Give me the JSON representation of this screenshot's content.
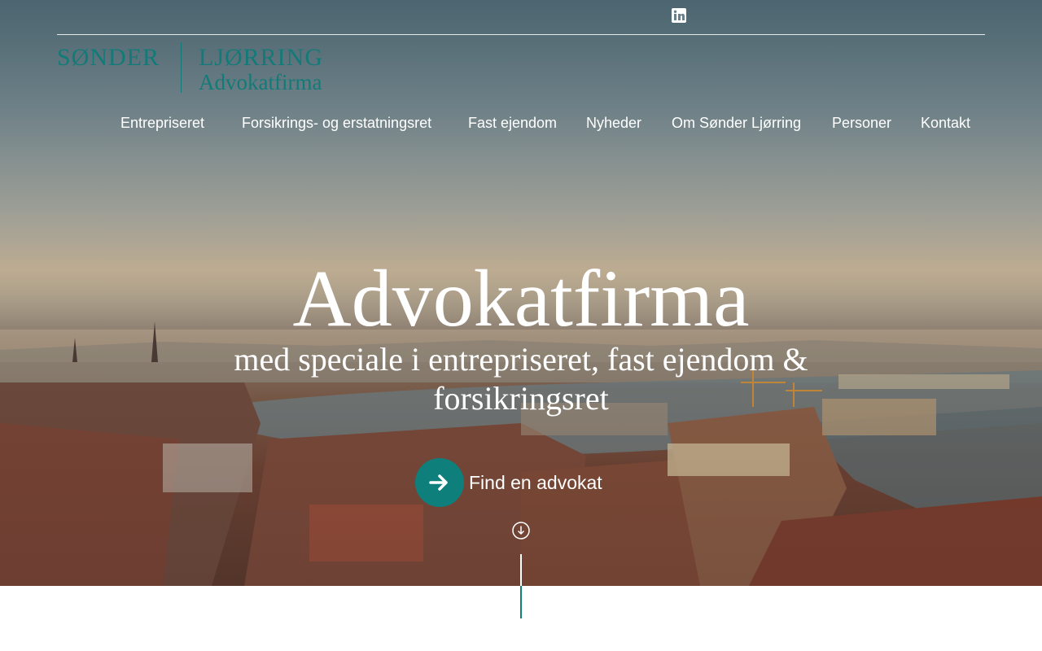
{
  "social": {
    "linkedin_icon": "linkedin-icon"
  },
  "logo": {
    "part1": "SØNDER",
    "part2": "LJØRRING",
    "part3": "Advokatfirma"
  },
  "nav": {
    "items": [
      {
        "label": "Entrepriseret"
      },
      {
        "label": "Forsikrings- og erstatningsret"
      },
      {
        "label": "Fast ejendom"
      },
      {
        "label": "Nyheder"
      },
      {
        "label": "Om Sønder Ljørring"
      },
      {
        "label": "Personer"
      },
      {
        "label": "Kontakt"
      }
    ]
  },
  "hero": {
    "title": "Advokatfirma",
    "subtitle": "med speciale i entrepriseret, fast ejendom & forsikringsret",
    "cta_label": "Find en advokat",
    "cta_icon": "arrow-right-icon",
    "scroll_icon": "arrow-down-circle-icon"
  },
  "colors": {
    "brand": "#0f7f7c",
    "text": "#ffffff"
  }
}
